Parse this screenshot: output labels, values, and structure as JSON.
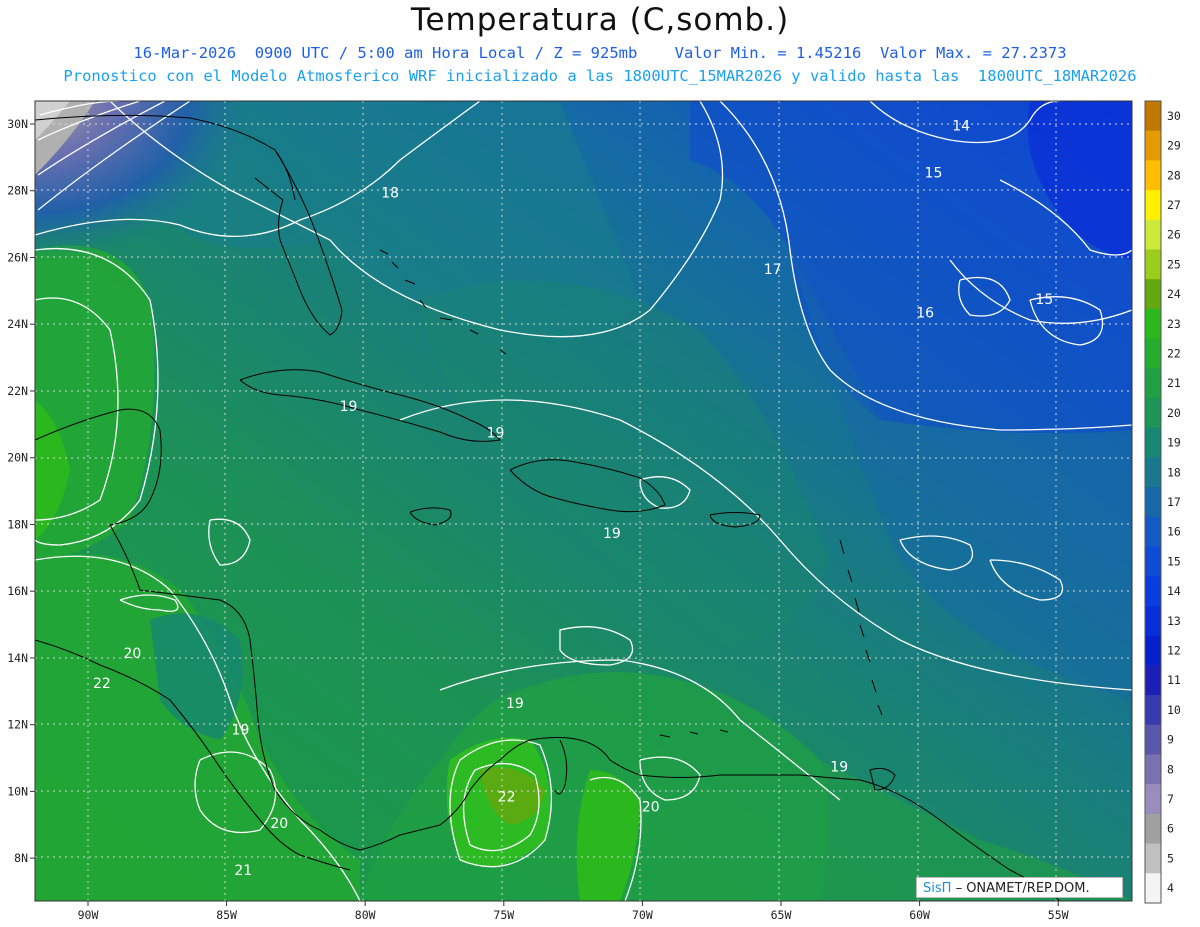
{
  "title": "Temperatura (C,somb.)",
  "subtitle_line1": "16-Mar-2026  0900 UTC / 5:00 am Hora Local / Z = 925mb    Valor Min. = 1.45216  Valor Max. = 27.2373",
  "subtitle_line2": "Pronostico con el Modelo Atmosferico WRF inicializado a las 1800UTC_15MAR2026 y valido hasta las  1800UTC_18MAR2026",
  "credit_brand": "SisΠ",
  "credit_text": "– ONAMET/REP.DOM.",
  "chart_data": {
    "type": "heatmap",
    "variable": "Temperatura (C,somb.)",
    "level": "925mb",
    "value_min": 1.45216,
    "value_max": 27.2373,
    "lon_ticks": [
      "90W",
      "85W",
      "80W",
      "75W",
      "70W",
      "65W",
      "60W",
      "55W"
    ],
    "lat_ticks": [
      "30N",
      "28N",
      "26N",
      "24N",
      "22N",
      "20N",
      "18N",
      "16N",
      "14N",
      "12N",
      "10N",
      "8N"
    ],
    "lon_range": [
      -92,
      -52
    ],
    "lat_range": [
      7,
      30.5
    ],
    "grid": true,
    "colorbar": {
      "levels": [
        30,
        29,
        28,
        27,
        26,
        25,
        24,
        23,
        22,
        21,
        20,
        19,
        18,
        17,
        16,
        15,
        14,
        13,
        12,
        11,
        10,
        9,
        8,
        7,
        6,
        5,
        4
      ],
      "colors": [
        "#c07800",
        "#e49a00",
        "#ffbf00",
        "#fff000",
        "#cdea3a",
        "#9bce1a",
        "#62a80e",
        "#2ab81e",
        "#24ac2e",
        "#1fa042",
        "#1d9458",
        "#178672",
        "#1a788e",
        "#1668a8",
        "#145ac4",
        "#0f4cd6",
        "#0a3dde",
        "#082ed8",
        "#0620cc",
        "#1b1fb6",
        "#3a3ab0",
        "#5a58ac",
        "#7a72b0",
        "#9a8dbe",
        "#a0a0a0",
        "#c0c0c0",
        "#f4f4f4"
      ]
    },
    "contour_labels": [
      {
        "text": "14",
        "lon": -58.5,
        "lat": 29.8
      },
      {
        "text": "15",
        "lon": -59.5,
        "lat": 28.4
      },
      {
        "text": "18",
        "lon": -79.1,
        "lat": 27.8
      },
      {
        "text": "17",
        "lon": -65.3,
        "lat": 25.5
      },
      {
        "text": "15",
        "lon": -55.5,
        "lat": 24.6
      },
      {
        "text": "16",
        "lon": -59.8,
        "lat": 24.2
      },
      {
        "text": "19",
        "lon": -80.6,
        "lat": 21.4
      },
      {
        "text": "19",
        "lon": -75.3,
        "lat": 20.6
      },
      {
        "text": "19",
        "lon": -71.1,
        "lat": 17.6
      },
      {
        "text": "20",
        "lon": -88.4,
        "lat": 14.0
      },
      {
        "text": "22",
        "lon": -89.5,
        "lat": 13.1
      },
      {
        "text": "19",
        "lon": -74.6,
        "lat": 12.5
      },
      {
        "text": "19",
        "lon": -84.5,
        "lat": 11.7
      },
      {
        "text": "19",
        "lon": -62.9,
        "lat": 10.6
      },
      {
        "text": "22",
        "lon": -74.9,
        "lat": 9.7
      },
      {
        "text": "20",
        "lon": -69.7,
        "lat": 9.4
      },
      {
        "text": "20",
        "lon": -83.1,
        "lat": 8.9
      },
      {
        "text": "21",
        "lon": -84.4,
        "lat": 7.5
      }
    ]
  }
}
